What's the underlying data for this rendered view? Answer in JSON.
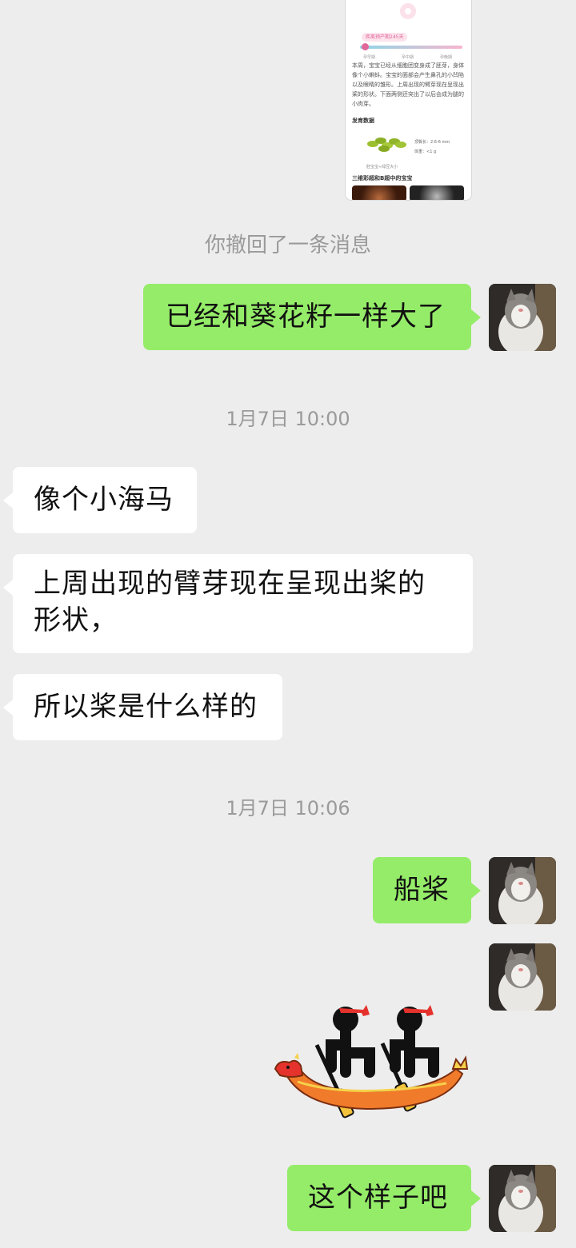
{
  "card": {
    "pill": "距离预产期245天",
    "ticks": [
      "孕早期",
      "孕中期",
      "孕晚期"
    ],
    "paragraph": "本周，宝宝已经从细胞团变身成了胚芽，身体像个小蝌蚪。宝宝的面部会产生鼻孔的小凹陷以及眼睛的雏形。上周出现的臂芽现在呈现出桨的形状。下面两侧还突出了以后会成为腿的小肉芽。",
    "section1": "发育数据",
    "stat_length": "顶臀长：2.6-6 mm",
    "stat_weight": "体重：<1 g",
    "caption": "胚宝宝≈绿豆大小",
    "section2": "三维彩超和B超中的宝宝"
  },
  "recalled_notice": "你撤回了一条消息",
  "messages": [
    {
      "side": "right",
      "text": "已经和葵花籽一样大了"
    },
    {
      "side": "left",
      "text": "像个小海马"
    },
    {
      "side": "left",
      "text": "上周出现的臂芽现在呈现出桨的形状，"
    },
    {
      "side": "left",
      "text": "所以桨是什么样的"
    },
    {
      "side": "right",
      "text": "船桨"
    },
    {
      "side": "right",
      "text": "这个样子吧"
    }
  ],
  "timestamps": [
    "1月7日 10:00",
    "1月7日 10:06"
  ],
  "sticker": "dragon-boat-rowers-sticker",
  "colors": {
    "background": "#ededed",
    "sent_bubble": "#95ec69",
    "received_bubble": "#ffffff",
    "timestamp": "#9a9a9a"
  }
}
